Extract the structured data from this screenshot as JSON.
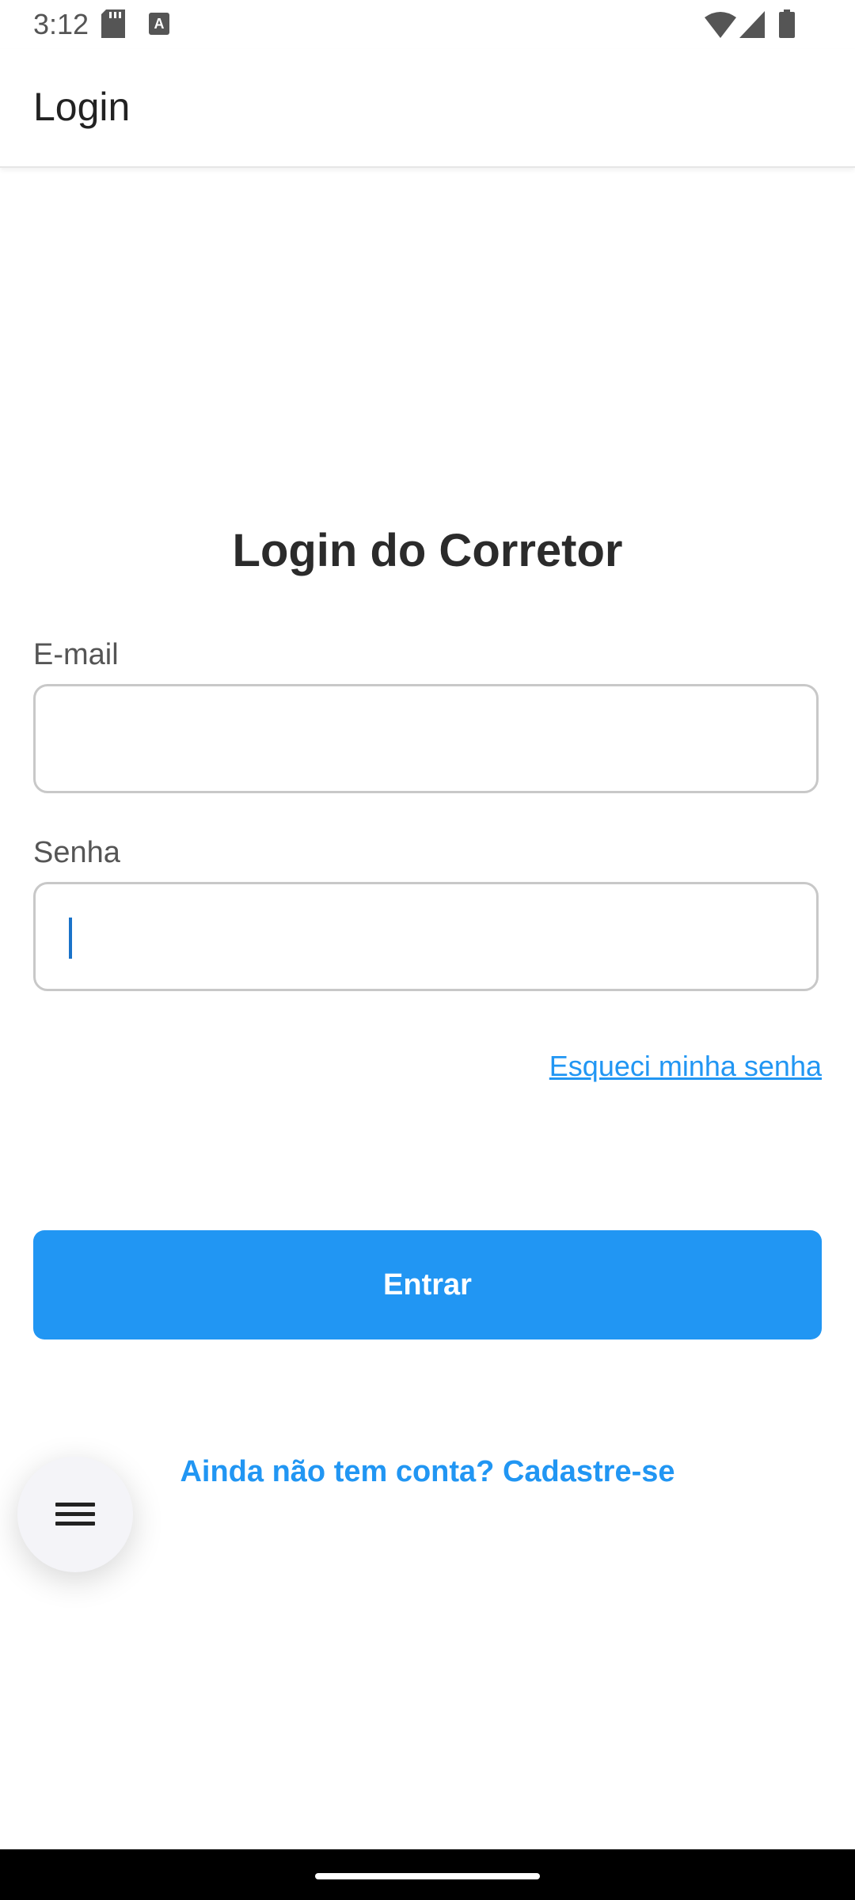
{
  "status_bar": {
    "time": "3:12",
    "icons": [
      "sd-card-icon",
      "keyboard-a-icon",
      "wifi-icon",
      "signal-icon",
      "battery-icon"
    ]
  },
  "app_bar": {
    "title": "Login"
  },
  "form": {
    "title": "Login do Corretor",
    "email_label": "E-mail",
    "email_value": "",
    "password_label": "Senha",
    "password_value": "",
    "forgot_link": "Esqueci minha senha",
    "submit_label": "Entrar",
    "signup_link": "Ainda não tem conta? Cadastre-se"
  },
  "fab": {
    "icon": "menu-icon"
  },
  "colors": {
    "accent": "#2196f3",
    "text_dark": "#2b2b2b",
    "text_label": "#555555",
    "field_border": "#c8c8c8",
    "caret": "#1a73c9"
  }
}
